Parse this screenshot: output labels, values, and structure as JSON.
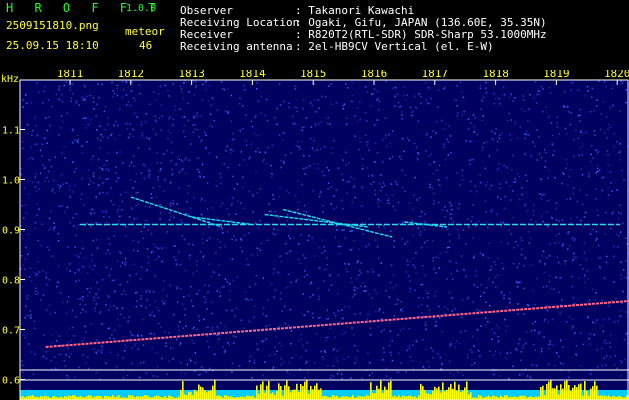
{
  "header": {
    "app_name": "H R O F F T",
    "version": "1.0.0",
    "filename": "2509151810.png",
    "label": "meteor",
    "datetime": "25.09.15 18:10",
    "count": "46",
    "info_labels": [
      "Observer",
      "Receiving Location",
      "Receiver",
      "Receiving antenna"
    ],
    "info_values": [
      ": Takanori Kawachi",
      ": Ogaki, Gifu, JAPAN (136.60E, 35.35N)",
      ": R820T2(RTL-SDR) SDR-Sharp 53.1000MHz",
      ": 2el-HB9CV Vertical (el. E-W)"
    ]
  },
  "chart_data": {
    "type": "heatmap",
    "ylabel": "kHz",
    "x_ticks": [
      "1811",
      "1812",
      "1813",
      "1814",
      "1815",
      "1816",
      "1817",
      "1818",
      "1819",
      "1820"
    ],
    "y_ticks": [
      "1.1",
      "1.0",
      "0.9",
      "0.8",
      "0.7",
      "0.6"
    ],
    "ylim": [
      0.6,
      1.15
    ],
    "carrier_freq": 0.91,
    "drift_line": [
      [
        1810.6,
        0.665
      ],
      [
        1820.3,
        0.758
      ]
    ],
    "meteor_echoes": [
      [
        [
          1812.0,
          0.965
        ],
        [
          1813.5,
          0.905
        ]
      ],
      [
        [
          1813.0,
          0.925
        ],
        [
          1814.0,
          0.91
        ]
      ],
      [
        [
          1814.5,
          0.94
        ],
        [
          1816.3,
          0.885
        ]
      ],
      [
        [
          1814.2,
          0.93
        ],
        [
          1815.9,
          0.905
        ]
      ],
      [
        [
          1816.5,
          0.915
        ],
        [
          1817.2,
          0.905
        ]
      ]
    ],
    "colors": {
      "background": "#000060",
      "frame": "#ffffff",
      "carrier": "#22ddee",
      "drift": "#ff6688",
      "bars": "#ffff00",
      "base": "#00ccff"
    }
  }
}
